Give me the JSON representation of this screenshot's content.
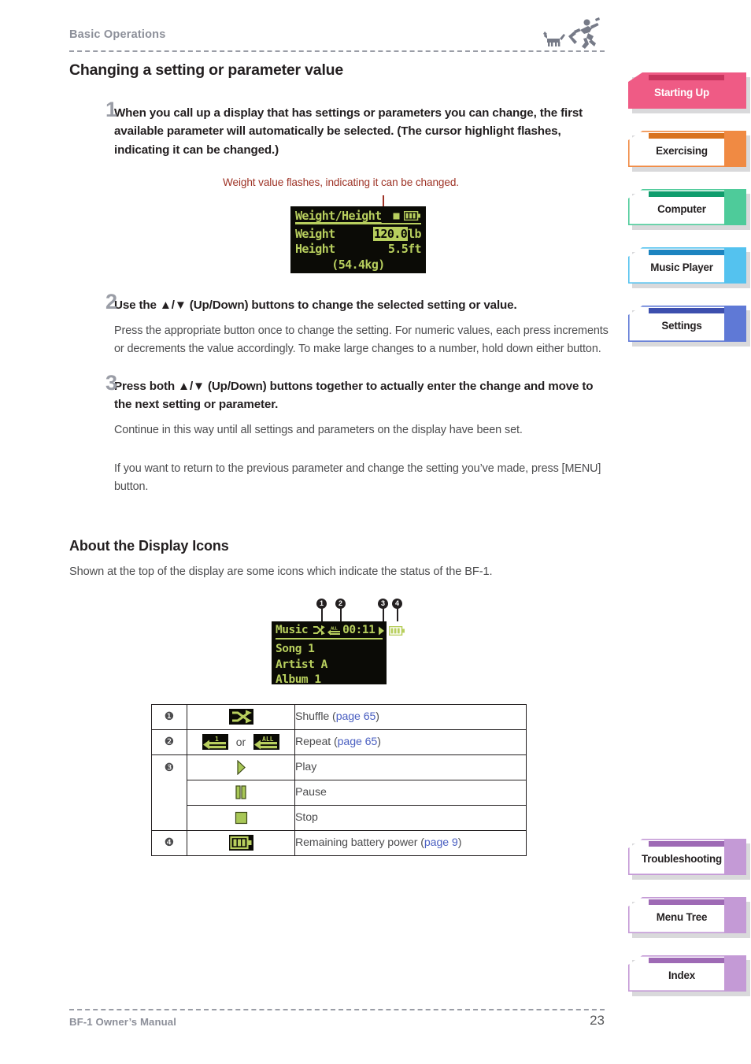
{
  "header": {
    "title": "Basic Operations",
    "icons": [
      "dog-icon",
      "runner-icon"
    ]
  },
  "main": {
    "section_title": "Changing a setting or parameter value",
    "steps": [
      {
        "num": "1",
        "lead": "When you call up a display that has settings or parameters you can change, the first available parameter will automatically be selected. (The cursor highlight flashes, indicating it can be changed.)",
        "body": ""
      },
      {
        "num": "2",
        "lead": "Use the ▲/▼ (Up/Down) buttons to change the selected setting or value.",
        "body": "Press the appropriate button once to change the setting. For numeric values, each press increments or decrements the value accordingly. To make large changes to a number, hold down either button."
      },
      {
        "num": "3",
        "lead": "Press both ▲/▼ (Up/Down) buttons together to actually enter the change and move to the next setting or parameter.",
        "body": "Continue in this way until all settings and parameters on the display have been set.",
        "body2": "If you want to return to the previous parameter and change the setting you’ve made, press [MENU] button."
      }
    ],
    "figure1_caption": "Weight value flashes, indicating it can be changed.",
    "display_icons_heading": "About the Display Icons",
    "display_icons_intro": "Shown at the top of the display are some icons which indicate the status of the BF-1."
  },
  "lcd_weight": {
    "title": "Weight/Height",
    "row1_label": "Weight",
    "row1_value": "120.0",
    "row1_unit": "lb",
    "row2_label": "Height",
    "row2_value": "5.5",
    "row2_unit": "ft",
    "row3": "(54.4kg)",
    "status_icons": [
      "stop-icon",
      "battery-icon"
    ],
    "screen_bg": "#0b0b06",
    "screen_fg": "#b8cf5e"
  },
  "lcd_music": {
    "title": "Music",
    "time": "00:11",
    "line1": "Song 1",
    "line2": "Artist A",
    "line3": "Album 1",
    "status_icons": [
      "shuffle-icon",
      "repeat-all-icon",
      "play-icon",
      "battery-icon"
    ],
    "callouts": [
      "1",
      "2",
      "3",
      "4"
    ]
  },
  "icon_table": {
    "rows": [
      {
        "num": "❶",
        "icon": "shuffle-icon",
        "text": "Shuffle (",
        "link": "page 65",
        "text_after": ")"
      },
      {
        "num": "❷",
        "icon": "repeat-one-icon or repeat-all-icon",
        "text": "Repeat (",
        "link": "page 65",
        "text_after": ")"
      },
      {
        "num": "❸",
        "icon": "play-icon",
        "text": "Play",
        "link": "",
        "text_after": ""
      },
      {
        "num": "",
        "icon": "pause-icon",
        "text": "Pause",
        "link": "",
        "text_after": ""
      },
      {
        "num": "",
        "icon": "stop-icon",
        "text": "Stop",
        "link": "",
        "text_after": ""
      },
      {
        "num": "❹",
        "icon": "battery-icon",
        "text": "Remaining battery power (",
        "link": "page 9",
        "text_after": ")"
      }
    ],
    "or_label": "or"
  },
  "tabs_top": [
    {
      "label": "Starting Up",
      "color": "#ef5b85",
      "top": "#c8355e",
      "active": true
    },
    {
      "label": "Exercising",
      "color": "#f08a43",
      "top": "#d9731f",
      "active": false
    },
    {
      "label": "Computer",
      "color": "#4ecb9a",
      "top": "#0f9d6d",
      "active": false
    },
    {
      "label": "Music Player",
      "color": "#54c2ef",
      "top": "#1c84c0",
      "active": false
    },
    {
      "label": "Settings",
      "color": "#5f79d6",
      "top": "#3d4fae",
      "active": false
    }
  ],
  "tabs_bottom": [
    {
      "label": "Troubleshooting",
      "color": "#c49ad6",
      "top": "#9e6ab5",
      "active": false
    },
    {
      "label": "Menu Tree",
      "color": "#c49ad6",
      "top": "#9e6ab5",
      "active": false
    },
    {
      "label": "Index",
      "color": "#c49ad6",
      "top": "#9e6ab5",
      "active": false
    }
  ],
  "footer": {
    "manual": "BF-1 Owner’s Manual",
    "page": "23"
  }
}
